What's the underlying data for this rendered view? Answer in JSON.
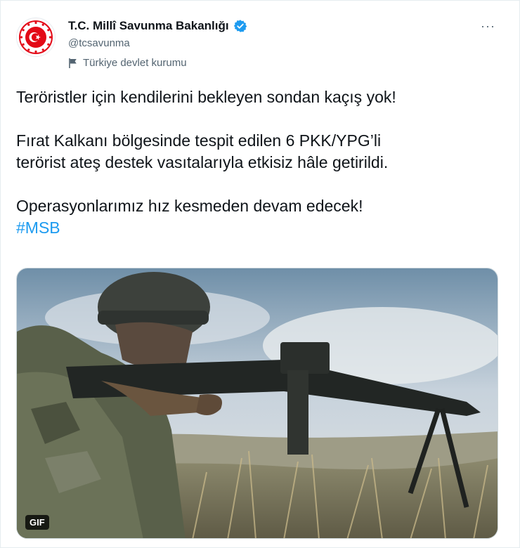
{
  "account": {
    "display_name": "T.C. Millî Savunma Bakanlığı",
    "handle": "@tcsavunma",
    "label": "Türkiye devlet kurumu",
    "avatar_icon": "ministry-emblem-icon",
    "verified_icon": "verified-badge-icon",
    "label_icon": "flag-icon"
  },
  "tweet": {
    "line1": "Teröristler için kendilerini bekleyen sondan kaçış yok!",
    "line2": "Fırat Kalkanı bölgesinde tespit edilen 6 PKK/YPG’li",
    "line3": "terörist ateş destek vasıtalarıyla etkisiz hâle getirildi.",
    "line4": "Operasyonlarımız hız kesmeden devam edecek!",
    "hashtag": "#MSB"
  },
  "media": {
    "badge": "GIF"
  },
  "menu": {
    "more_label": "···"
  },
  "colors": {
    "accent": "#1d9bf0",
    "emblem_red": "#e30a17",
    "secondary_text": "#536471"
  }
}
